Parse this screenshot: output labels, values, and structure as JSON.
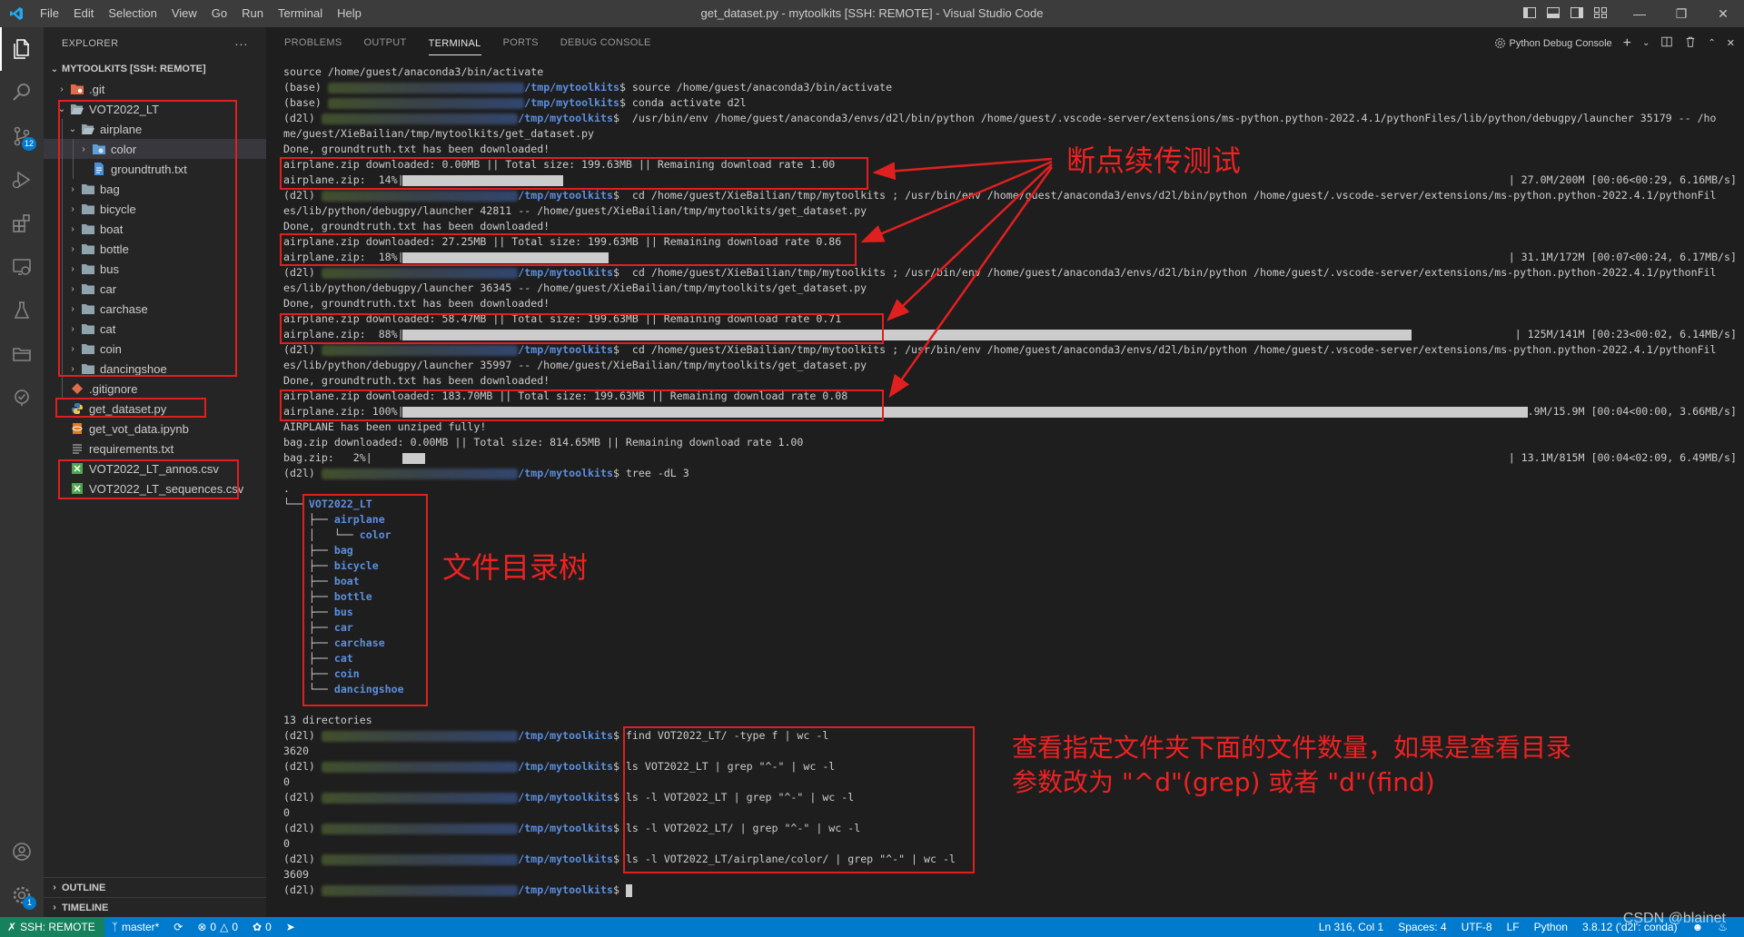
{
  "window": {
    "title": "get_dataset.py - mytoolkits [SSH: REMOTE] - Visual Studio Code",
    "menu": [
      "File",
      "Edit",
      "Selection",
      "View",
      "Go",
      "Run",
      "Terminal",
      "Help"
    ]
  },
  "activity_bar": {
    "items": [
      "explorer-icon",
      "search-icon",
      "source-control-icon",
      "run-debug-icon",
      "extensions-icon",
      "remote-explorer-icon",
      "testing-icon",
      "folder-icon",
      "check-icon"
    ],
    "source_control_badge": "12",
    "account_icon": "account-icon",
    "settings_badge": "1"
  },
  "sidebar": {
    "header": "EXPLORER",
    "more": "···",
    "root": "MYTOOLKITS [SSH: REMOTE]",
    "tree": [
      {
        "label": ".git",
        "type": "folder-git"
      },
      {
        "label": "VOT2022_LT",
        "type": "folder-open"
      },
      {
        "label": "airplane",
        "type": "folder-open"
      },
      {
        "label": "color",
        "type": "folder-color"
      },
      {
        "label": "groundtruth.txt",
        "type": "file-txt"
      },
      {
        "label": "bag",
        "type": "folder"
      },
      {
        "label": "bicycle",
        "type": "folder"
      },
      {
        "label": "boat",
        "type": "folder"
      },
      {
        "label": "bottle",
        "type": "folder"
      },
      {
        "label": "bus",
        "type": "folder"
      },
      {
        "label": "car",
        "type": "folder"
      },
      {
        "label": "carchase",
        "type": "folder"
      },
      {
        "label": "cat",
        "type": "folder"
      },
      {
        "label": "coin",
        "type": "folder"
      },
      {
        "label": "dancingshoe",
        "type": "folder"
      },
      {
        "label": ".gitignore",
        "type": "file-git"
      },
      {
        "label": "get_dataset.py",
        "type": "file-py"
      },
      {
        "label": "get_vot_data.ipynb",
        "type": "file-ipynb"
      },
      {
        "label": "requirements.txt",
        "type": "file-lines"
      },
      {
        "label": "VOT2022_LT_annos.csv",
        "type": "file-csv"
      },
      {
        "label": "VOT2022_LT_sequences.csv",
        "type": "file-csv"
      }
    ],
    "outline": "OUTLINE",
    "timeline": "TIMELINE"
  },
  "panel": {
    "tabs": [
      "PROBLEMS",
      "OUTPUT",
      "TERMINAL",
      "PORTS",
      "DEBUG CONSOLE"
    ],
    "active_tab": "TERMINAL",
    "terminal_name": "Python Debug Console"
  },
  "terminal": {
    "prompt_path": "/tmp/mytoolkits",
    "lines": {
      "l0": "source /home/guest/anaconda3/bin/activate",
      "l1_env": "(base) ",
      "l1_cmd": "$ source /home/guest/anaconda3/bin/activate",
      "l2_env": "(base) ",
      "l2_cmd": "$ conda activate d2l",
      "l3_env": "(d2l) ",
      "l3_cmd": "$  /usr/bin/env /home/guest/anaconda3/envs/d2l/bin/python /home/guest/.vscode-server/extensions/ms-python.python-2022.4.1/pythonFiles/lib/python/debugpy/launcher 35179 -- /ho",
      "l4": "me/guest/XieBailian/tmp/mytoolkits/get_dataset.py",
      "l5": "Done, groundtruth.txt has been downloaded!",
      "l6": "airplane.zip downloaded: 0.00MB || Total size: 199.63MB || Remaining download rate 1.00",
      "l7": "airplane.zip:  14%|",
      "l7_info": "| 27.0M/200M [00:06<00:29, 6.16MB/s]",
      "l8_env": "(d2l) ",
      "l8_cmd": "$  cd /home/guest/XieBailian/tmp/mytoolkits ; /usr/bin/env /home/guest/anaconda3/envs/d2l/bin/python /home/guest/.vscode-server/extensions/ms-python.python-2022.4.1/pythonFil",
      "l9": "es/lib/python/debugpy/launcher 42811 -- /home/guest/XieBailian/tmp/mytoolkits/get_dataset.py",
      "l10": "Done, groundtruth.txt has been downloaded!",
      "l11": "airplane.zip downloaded: 27.25MB || Total size: 199.63MB || Remaining download rate 0.86",
      "l12": "airplane.zip:  18%|",
      "l12_info": "| 31.1M/172M [00:07<00:24, 6.17MB/s]",
      "l13_env": "(d2l) ",
      "l13_cmd": "$  cd /home/guest/XieBailian/tmp/mytoolkits ; /usr/bin/env /home/guest/anaconda3/envs/d2l/bin/python /home/guest/.vscode-server/extensions/ms-python.python-2022.4.1/pythonFil",
      "l14": "es/lib/python/debugpy/launcher 36345 -- /home/guest/XieBailian/tmp/mytoolkits/get_dataset.py",
      "l15": "Done, groundtruth.txt has been downloaded!",
      "l16": "airplane.zip downloaded: 58.47MB || Total size: 199.63MB || Remaining download rate 0.71",
      "l17": "airplane.zip:  88%|",
      "l17_info": "| 125M/141M [00:23<00:02, 6.14MB/s]",
      "l18_env": "(d2l) ",
      "l18_cmd": "$  cd /home/guest/XieBailian/tmp/mytoolkits ; /usr/bin/env /home/guest/anaconda3/envs/d2l/bin/python /home/guest/.vscode-server/extensions/ms-python.python-2022.4.1/pythonFil",
      "l19": "es/lib/python/debugpy/launcher 35997 -- /home/guest/XieBailian/tmp/mytoolkits/get_dataset.py",
      "l20": "Done, groundtruth.txt has been downloaded!",
      "l21": "airplane.zip downloaded: 183.70MB || Total size: 199.63MB || Remaining download rate 0.08",
      "l22": "airplane.zip: 100%|",
      "l22_info": "| 15.9M/15.9M [00:04<00:00, 3.66MB/s]",
      "l23": "AIRPLANE has been unziped fully!",
      "l24": "bag.zip downloaded: 0.00MB || Total size: 814.65MB || Remaining download rate 1.00",
      "l25": "bag.zip:   2%|",
      "l25_info": "| 13.1M/815M [00:04<02:09, 6.49MB/s]",
      "l26_env": "(d2l) ",
      "l26_cmd": "$ tree -dL 3",
      "l27": ".",
      "tree_root": "VOT2022_LT",
      "tree_airplane": "airplane",
      "tree_color": "color",
      "tree_items": [
        "bag",
        "bicycle",
        "boat",
        "bottle",
        "bus",
        "car",
        "carchase",
        "cat",
        "coin",
        "dancingshoe"
      ],
      "dirs_count": "13 directories",
      "c1_env": "(d2l) ",
      "c1_cmd": "$ find VOT2022_LT/ -type f | wc -l",
      "c1_out": "3620",
      "c2_env": "(d2l) ",
      "c2_cmd": "$ ls VOT2022_LT | grep \"^-\" | wc -l",
      "c2_out": "0",
      "c3_env": "(d2l) ",
      "c3_cmd": "$ ls -l VOT2022_LT | grep \"^-\" | wc -l",
      "c3_out": "0",
      "c4_env": "(d2l) ",
      "c4_cmd": "$ ls -l VOT2022_LT/ | grep \"^-\" | wc -l",
      "c4_out": "0",
      "c5_env": "(d2l) ",
      "c5_cmd": "$ ls -l VOT2022_LT/airplane/color/ | grep \"^-\" | wc -l",
      "c5_out": "3609",
      "last_env": "(d2l) ",
      "last_cmd": "$ "
    },
    "progress": {
      "p7": 0.14,
      "p12": 0.18,
      "p17": 0.88,
      "p22": 1.0,
      "p25": 0.02
    }
  },
  "annotations": {
    "resume_test": "断点续传测试",
    "dir_tree": "文件目录树",
    "count_note_line1": "查看指定文件夹下面的文件数量，如果是查看目录",
    "count_note_line2": "参数改为 \"^d\"(grep) 或者 \"d\"(find)",
    "color": "#e02020"
  },
  "statusbar": {
    "remote": "SSH: REMOTE",
    "branch": "master*",
    "errors": "0",
    "warnings": "0",
    "ports": "0",
    "position": "Ln 316, Col 1",
    "spaces": "Spaces: 4",
    "encoding": "UTF-8",
    "eol": "LF",
    "language": "Python",
    "interpreter": "3.8.12 ('d2l': conda)"
  },
  "watermark": "CSDN @blainet"
}
